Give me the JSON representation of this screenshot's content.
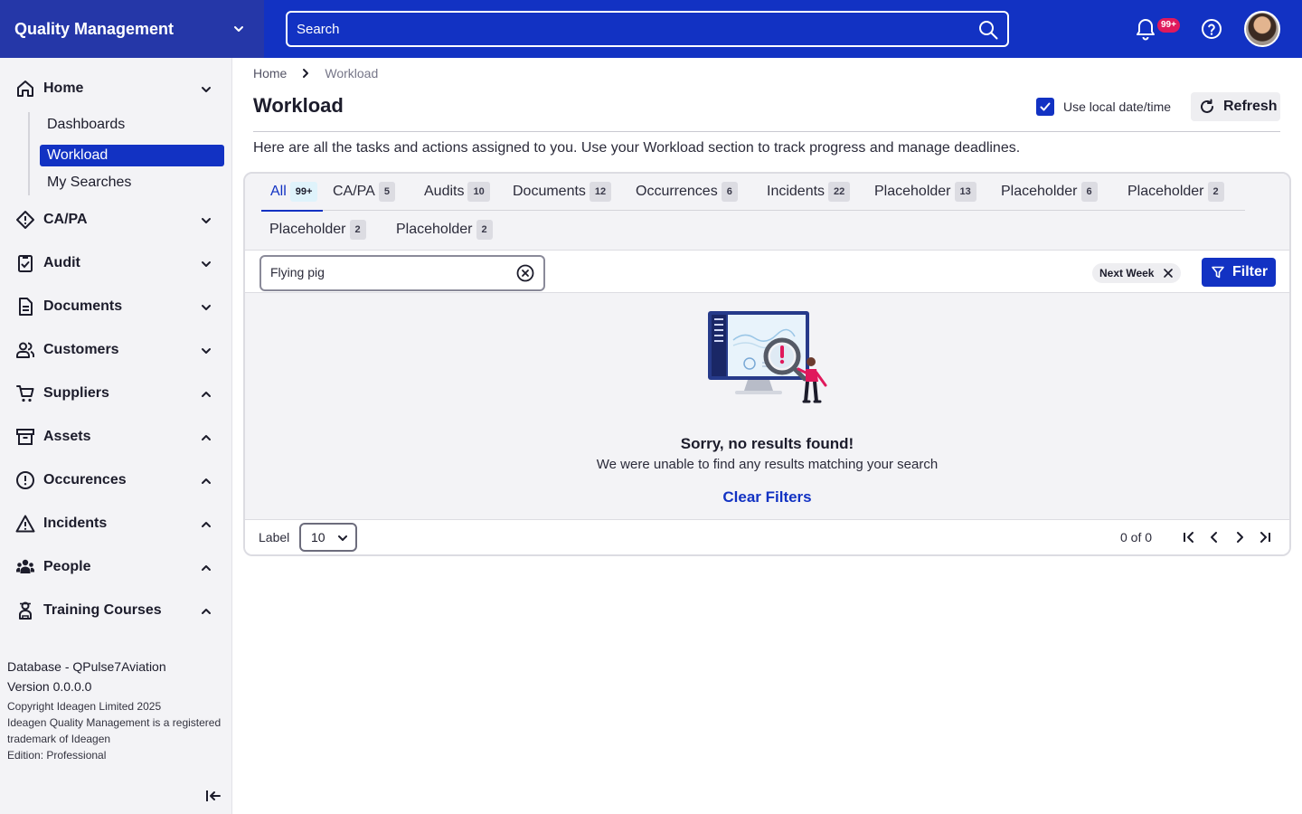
{
  "app": {
    "title": "Quality Management",
    "search_placeholder": "Search",
    "notification_count": "99+"
  },
  "sidebar": {
    "home": {
      "label": "Home",
      "children": [
        "Dashboards",
        "Workload",
        "My Searches"
      ],
      "active_child": "Workload"
    },
    "items": [
      {
        "label": "CA/PA",
        "icon": "diamond-icon",
        "expanded": false
      },
      {
        "label": "Audit",
        "icon": "clipboard-check-icon",
        "expanded": false
      },
      {
        "label": "Documents",
        "icon": "document-icon",
        "expanded": false
      },
      {
        "label": "Customers",
        "icon": "users-icon",
        "expanded": false
      },
      {
        "label": "Suppliers",
        "icon": "cart-icon",
        "expanded": true
      },
      {
        "label": "Assets",
        "icon": "archive-icon",
        "expanded": true
      },
      {
        "label": "Occurences",
        "icon": "alert-circle-icon",
        "expanded": true
      },
      {
        "label": "Incidents",
        "icon": "warning-triangle-icon",
        "expanded": true
      },
      {
        "label": "People",
        "icon": "people-icon",
        "expanded": true
      },
      {
        "label": "Training Courses",
        "icon": "training-icon",
        "expanded": true
      }
    ],
    "footer": {
      "database": "Database - QPulse7Aviation",
      "version": "Version 0.0.0.0",
      "copyright": "Copyright Ideagen Limited 2025",
      "trademark": "Ideagen Quality Management is a registered trademark of Ideagen",
      "edition": "Edition: Professional"
    }
  },
  "breadcrumb": [
    "Home",
    "Workload"
  ],
  "page": {
    "title": "Workload",
    "local_time_label": "Use local date/time",
    "local_time_checked": true,
    "refresh_label": "Refresh",
    "description": "Here are all the tasks and actions assigned to you. Use your Workload section to track progress and manage deadlines."
  },
  "tabs": [
    {
      "label": "All",
      "count": "99+",
      "active": true
    },
    {
      "label": "CA/PA",
      "count": "5"
    },
    {
      "label": "Audits",
      "count": "10"
    },
    {
      "label": "Documents",
      "count": "12"
    },
    {
      "label": "Occurrences",
      "count": "6"
    },
    {
      "label": "Incidents",
      "count": "22"
    },
    {
      "label": "Placeholder",
      "count": "13"
    },
    {
      "label": "Placeholder",
      "count": "6"
    },
    {
      "label": "Placeholder",
      "count": "2"
    },
    {
      "label": "Placeholder",
      "count": "2"
    },
    {
      "label": "Placeholder",
      "count": "2"
    }
  ],
  "filters": {
    "search_value": "Flying pig",
    "chip": "Next Week",
    "filter_label": "Filter"
  },
  "empty": {
    "title": "Sorry, no results found!",
    "subtitle": "We were unable to find any results matching your search",
    "action": "Clear Filters"
  },
  "pagination": {
    "label": "Label",
    "page_size": "10",
    "count": "0 of 0"
  },
  "colors": {
    "brand": "#1232c3",
    "brand_dark": "#2537a8",
    "badge": "#e0195c"
  }
}
